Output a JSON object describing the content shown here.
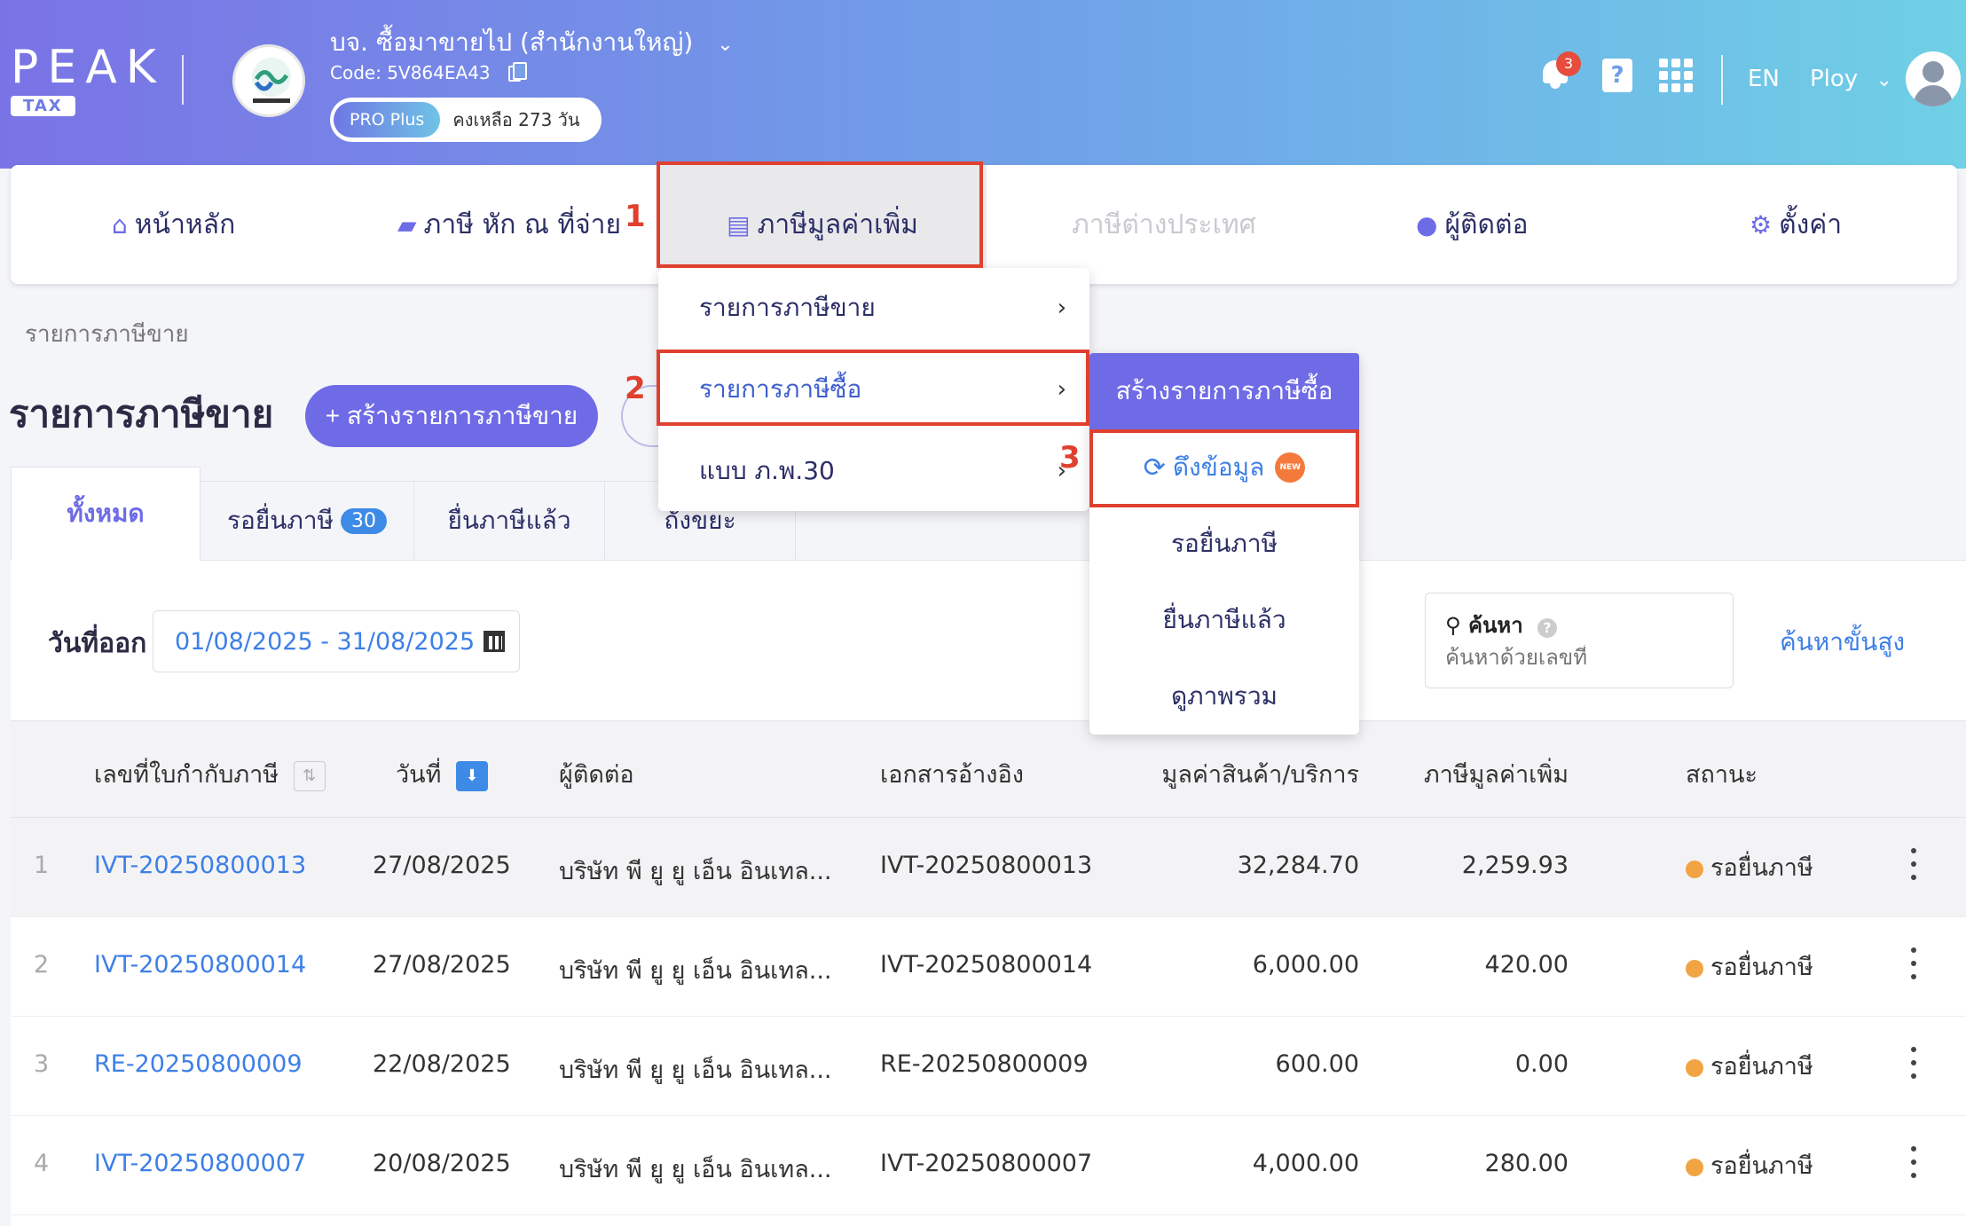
{
  "header": {
    "logo_text": "PEAK",
    "logo_sub": "TAX",
    "company_name": "บจ. ซื้อมาขายไป (สำนักงานใหญ่)",
    "company_code": "Code: 5V864EA43",
    "plan_name": "PRO Plus",
    "plan_remaining": "คงเหลือ 273 วัน",
    "notification_count": "3",
    "help_label": "?",
    "language": "EN",
    "user_name": "Ploy"
  },
  "nav": {
    "items": [
      {
        "label": "หน้าหลัก",
        "icon": "home-icon"
      },
      {
        "label": "ภาษี หัก ณ ที่จ่าย",
        "icon": "wallet-icon"
      },
      {
        "label": "ภาษีมูลค่าเพิ่ม",
        "icon": "document-icon"
      },
      {
        "label": "ภาษีต่างประเทศ",
        "icon": ""
      },
      {
        "label": "ผู้ติดต่อ",
        "icon": "person-icon"
      },
      {
        "label": "ตั้งค่า",
        "icon": "gear-icon"
      }
    ]
  },
  "steps": [
    "1",
    "2",
    "3"
  ],
  "vat_menu": {
    "items": [
      {
        "label": "รายการภาษีขาย"
      },
      {
        "label": "รายการภาษีซื้อ"
      },
      {
        "label": "แบบ ภ.พ.30"
      }
    ]
  },
  "purchase_submenu": {
    "create_label": "สร้างรายการภาษีซื้อ",
    "fetch_label": "ดึงข้อมูล",
    "new_badge": "NEW",
    "items": [
      "รอยื่นภาษี",
      "ยื่นภาษีแล้ว",
      "ดูภาพรวม"
    ]
  },
  "page": {
    "breadcrumb": "รายการภาษีขาย",
    "title": "รายการภาษีขาย",
    "create_button": "+ สร้างรายการภาษีขาย"
  },
  "tabs": [
    {
      "label": "ทั้งหมด"
    },
    {
      "label": "รอยื่นภาษี",
      "count": "30"
    },
    {
      "label": "ยื่นภาษีแล้ว"
    },
    {
      "label": "ถังขยะ"
    }
  ],
  "filters": {
    "date_label": "วันที่ออก",
    "date_range": "01/08/2025 - 31/08/2025",
    "search_label": "ค้นหา",
    "search_help": "?",
    "search_placeholder": "ค้นหาด้วยเลขที่",
    "advanced_search": "ค้นหาขั้นสูง"
  },
  "table": {
    "columns": [
      "เลขที่ใบกำกับภาษี",
      "วันที่",
      "ผู้ติดต่อ",
      "เอกสารอ้างอิง",
      "มูลค่าสินค้า/บริการ",
      "ภาษีมูลค่าเพิ่ม",
      "สถานะ"
    ],
    "sort_icons": {
      "doc": "⇅",
      "date": "⬇"
    },
    "rows": [
      {
        "no": "1",
        "doc": "IVT-20250800013",
        "date": "27/08/2025",
        "contact": "บริษัท พี ยู ยู เอ็น อินเทล...",
        "ref": "IVT-20250800013",
        "amount": "32,284.70",
        "vat": "2,259.93",
        "status": "รอยื่นภาษี"
      },
      {
        "no": "2",
        "doc": "IVT-20250800014",
        "date": "27/08/2025",
        "contact": "บริษัท พี ยู ยู เอ็น อินเทล...",
        "ref": "IVT-20250800014",
        "amount": "6,000.00",
        "vat": "420.00",
        "status": "รอยื่นภาษี"
      },
      {
        "no": "3",
        "doc": "RE-20250800009",
        "date": "22/08/2025",
        "contact": "บริษัท พี ยู ยู เอ็น อินเทล...",
        "ref": "RE-20250800009",
        "amount": "600.00",
        "vat": "0.00",
        "status": "รอยื่นภาษี"
      },
      {
        "no": "4",
        "doc": "IVT-20250800007",
        "date": "20/08/2025",
        "contact": "บริษัท พี ยู ยู เอ็น อินเทล...",
        "ref": "IVT-20250800007",
        "amount": "4,000.00",
        "vat": "280.00",
        "status": "รอยื่นภาษี"
      }
    ]
  },
  "colors": {
    "accent": "#6f6be6",
    "link": "#3d7fe6",
    "highlight": "#e0402f",
    "status_pending": "#f2a443"
  }
}
